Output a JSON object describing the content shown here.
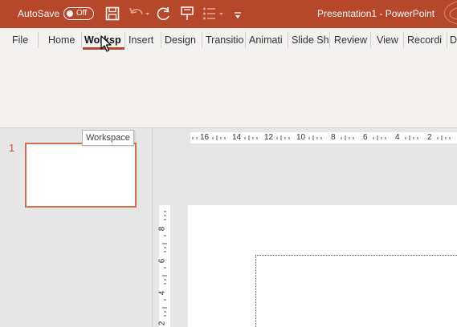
{
  "titlebar": {
    "autosave_label": "AutoSave",
    "autosave_state": "Off",
    "document_title": "Presentation1  -  PowerPoint",
    "quick_access_icons": [
      "save-icon",
      "undo-icon",
      "redo-icon",
      "touch-mode-icon",
      "bullets-icon",
      "customize-toolbar-icon"
    ]
  },
  "tabs": [
    {
      "label": "File"
    },
    {
      "label": "Home"
    },
    {
      "label": "Worksp",
      "active": true
    },
    {
      "label": "Insert"
    },
    {
      "label": "Design"
    },
    {
      "label": "Transitio"
    },
    {
      "label": "Animati"
    },
    {
      "label": "Slide Sh"
    },
    {
      "label": "Review"
    },
    {
      "label": "View"
    },
    {
      "label": "Recordi"
    },
    {
      "label": "D"
    }
  ],
  "tooltip": {
    "text": "Workspace"
  },
  "thumbnails": [
    {
      "number": "1"
    }
  ],
  "rulers": {
    "horizontal_labels": [
      "16",
      "14",
      "12",
      "10",
      "8",
      "6",
      "4",
      "2"
    ],
    "vertical_labels": [
      "8",
      "6",
      "4",
      "2"
    ]
  },
  "colors": {
    "accent": "#b7472a",
    "selection": "#d0704f"
  }
}
